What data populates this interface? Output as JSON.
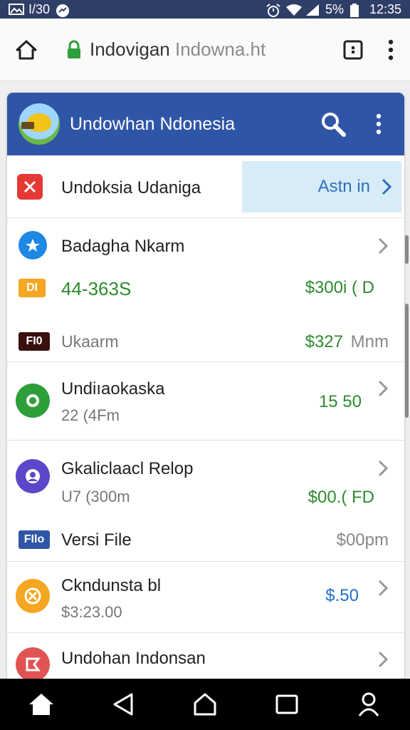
{
  "status_bar": {
    "left_text": "I/30",
    "battery": "5%",
    "time": "12:35",
    "icons": [
      "image-icon",
      "messenger-icon",
      "alarm-icon",
      "wifi-icon",
      "signal-icon",
      "battery-icon"
    ]
  },
  "browser": {
    "url_site": "Indovigan",
    "url_host": "Indowna.ht",
    "icons": [
      "home-icon",
      "lock-icon",
      "tab-switcher-icon",
      "more-vertical-icon"
    ]
  },
  "app": {
    "title": "Undowhan Ndonesia",
    "header_color": "#2f55a6",
    "icons": [
      "logo-icon",
      "search-icon",
      "more-vertical-icon"
    ]
  },
  "rows": {
    "r1": {
      "label": "Undoksia Udaniga",
      "action": "Astn in",
      "icon": "close-icon",
      "icon_color": "#e53935"
    },
    "r2": {
      "label": "Badagha Nkarm",
      "icon": "star-icon",
      "icon_color": "#1e88e5"
    },
    "r2a": {
      "tag": "DI",
      "label": "44-363S",
      "amount": "$300i ( D",
      "tag_color": "#f5a623"
    },
    "r2b": {
      "tag": "FI0",
      "label": "Ukaarm",
      "amount": "$327",
      "amount_suffix": "Mnm",
      "tag_color": "#3a0f0f"
    },
    "r3": {
      "label": "Undiıaokaska",
      "sub": "22 (4Fm",
      "amount": "15 50",
      "icon": "chat-icon",
      "icon_color": "#2e9e3a"
    },
    "r4": {
      "label": "Gkaliclaacl Relop",
      "sub": "U7 (300m",
      "amount": "$00.( FD",
      "icon": "user-icon",
      "icon_color": "#5b47c9"
    },
    "r4b": {
      "tag": "FIlo",
      "label": "Versi File",
      "amount": "$00pm",
      "tag_color": "#2f55a6"
    },
    "r5": {
      "label": "Ckndunsta bl",
      "sub": "$3:23.00",
      "amount": "$.50",
      "icon": "x-circle-icon",
      "icon_color": "#f5a623"
    },
    "r6": {
      "label": "Undohan Indonsan",
      "icon": "flag-icon",
      "icon_color": "#e05353"
    }
  },
  "nav": {
    "icons": [
      "home-icon",
      "back-icon",
      "home-outline-icon",
      "recents-icon",
      "profile-icon"
    ]
  }
}
